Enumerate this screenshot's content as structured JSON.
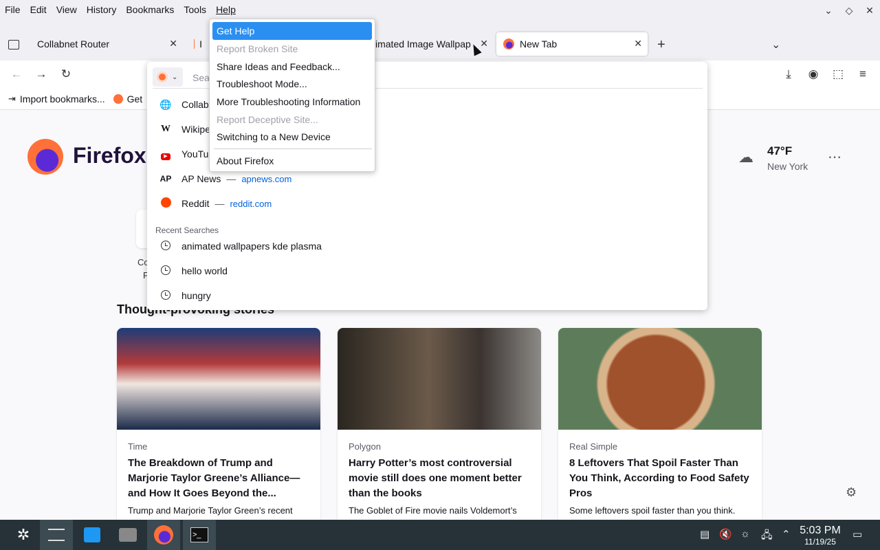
{
  "menubar": {
    "items": [
      "File",
      "Edit",
      "View",
      "History",
      "Bookmarks",
      "Tools",
      "Help"
    ]
  },
  "tabs": [
    {
      "title": "Collabnet Router"
    },
    {
      "title": "I"
    },
    {
      "title": "imated Image Wallpap"
    },
    {
      "title": "New Tab"
    }
  ],
  "urlbar": {
    "placeholder": "Search"
  },
  "bookmarks": {
    "import_label": "Import bookmarks...",
    "item2": "Get"
  },
  "suggestions": [
    {
      "title": "Collab",
      "url": ""
    },
    {
      "title": "Wikipe",
      "url": ""
    },
    {
      "title": "YouTu",
      "url": ""
    },
    {
      "title": "AP News",
      "url": "apnews.com"
    },
    {
      "title": "Reddit",
      "url": "reddit.com"
    }
  ],
  "recent": {
    "header": "Recent Searches",
    "items": [
      "animated wallpapers kde plasma",
      "hello world",
      "hungry"
    ]
  },
  "helpmenu": {
    "items": [
      {
        "label": "Get Help",
        "state": "highlighted"
      },
      {
        "label": "Report Broken Site",
        "state": "disabled"
      },
      {
        "label": "Share Ideas and Feedback...",
        "state": "normal"
      },
      {
        "label": "Troubleshoot Mode...",
        "state": "normal"
      },
      {
        "label": "More Troubleshooting Information",
        "state": "normal"
      },
      {
        "label": "Report Deceptive Site...",
        "state": "disabled"
      },
      {
        "label": "Switching to a New Device",
        "state": "normal"
      },
      {
        "label": "About Firefox",
        "state": "normal"
      }
    ]
  },
  "newtab": {
    "brand": "Firefox",
    "weather": {
      "temp": "47°F",
      "city": "New York"
    },
    "shortcut_label_1": "Co",
    "shortcut_label_2": "F",
    "stories_title": "Thought-provoking stories",
    "stories": [
      {
        "source": "Time",
        "title": "The Breakdown of Trump and Marjorie Taylor Greene’s Alliance—and How It Goes Beyond the...",
        "desc": "Trump and Marjorie Taylor Green’s recent"
      },
      {
        "source": "Polygon",
        "title": "Harry Potter’s most controversial movie still does one moment better than the books",
        "desc": "The Goblet of Fire movie nails Voldemort’s"
      },
      {
        "source": "Real Simple",
        "title": "8 Leftovers That Spoil Faster Than You Think, According to Food Safety Pros",
        "desc": "Some leftovers spoil faster than you think."
      }
    ]
  },
  "taskbar": {
    "time": "5:03 PM",
    "date": "11/19/25"
  },
  "colors": {
    "accent": "#2a8ff0",
    "link": "#0060df",
    "taskbar": "#263238"
  }
}
